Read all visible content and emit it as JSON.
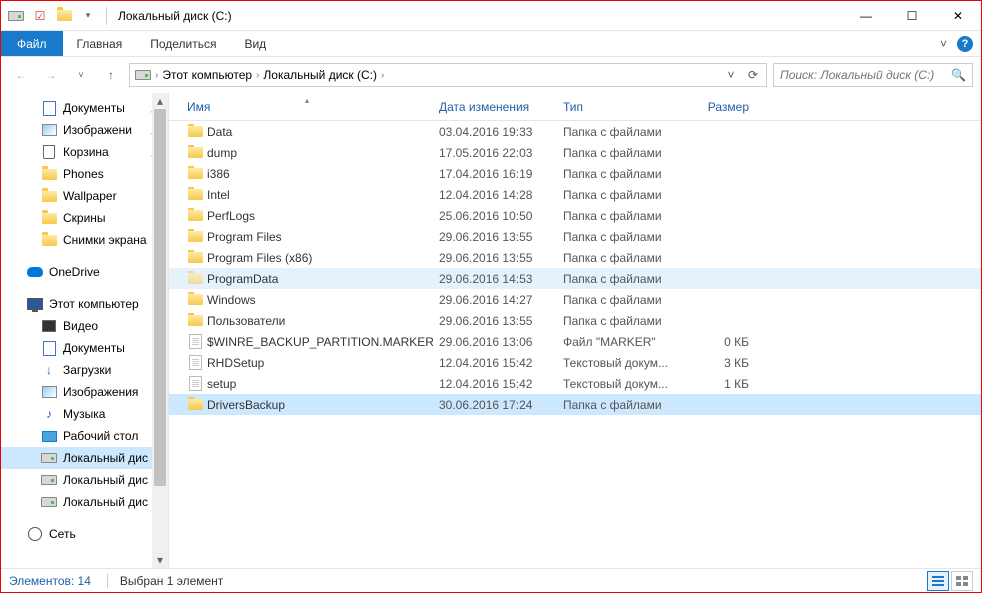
{
  "window": {
    "title": "Локальный диск (C:)",
    "minimize": "—",
    "maximize": "☐",
    "close": "✕"
  },
  "ribbon": {
    "file": "Файл",
    "tabs": [
      "Главная",
      "Поделиться",
      "Вид"
    ],
    "help": "?"
  },
  "nav": {
    "back": "←",
    "forward": "→",
    "up": "↑",
    "refresh": "⟳",
    "dropdown": "˅"
  },
  "address": {
    "crumbs": [
      "Этот компьютер",
      "Локальный диск (C:)"
    ],
    "sep": "›"
  },
  "search": {
    "placeholder": "Поиск: Локальный диск (C:)",
    "icon": "🔍"
  },
  "navpane": {
    "quickaccess": [
      {
        "label": "Документы",
        "icon": "doc",
        "pinned": true
      },
      {
        "label": "Изображени",
        "icon": "pic",
        "pinned": true
      },
      {
        "label": "Корзина",
        "icon": "trash",
        "pinned": true
      },
      {
        "label": "Phones",
        "icon": "folder"
      },
      {
        "label": "Wallpaper",
        "icon": "folder"
      },
      {
        "label": "Скрины",
        "icon": "folder"
      },
      {
        "label": "Снимки экрана",
        "icon": "folder"
      }
    ],
    "onedrive": "OneDrive",
    "thispc": "Этот компьютер",
    "thispc_items": [
      {
        "label": "Видео",
        "icon": "vid"
      },
      {
        "label": "Документы",
        "icon": "doc"
      },
      {
        "label": "Загрузки",
        "icon": "down"
      },
      {
        "label": "Изображения",
        "icon": "pic"
      },
      {
        "label": "Музыка",
        "icon": "music"
      },
      {
        "label": "Рабочий стол",
        "icon": "desk"
      },
      {
        "label": "Локальный дис",
        "icon": "drive",
        "selected": true
      },
      {
        "label": "Локальный дис",
        "icon": "drive"
      },
      {
        "label": "Локальный дис",
        "icon": "drive"
      }
    ],
    "network": "Сеть"
  },
  "columns": {
    "name": "Имя",
    "date": "Дата изменения",
    "type": "Тип",
    "size": "Размер"
  },
  "files": [
    {
      "name": "Data",
      "date": "03.04.2016 19:33",
      "type": "Папка с файлами",
      "size": "",
      "icon": "folder"
    },
    {
      "name": "dump",
      "date": "17.05.2016 22:03",
      "type": "Папка с файлами",
      "size": "",
      "icon": "folder"
    },
    {
      "name": "i386",
      "date": "17.04.2016 16:19",
      "type": "Папка с файлами",
      "size": "",
      "icon": "folder"
    },
    {
      "name": "Intel",
      "date": "12.04.2016 14:28",
      "type": "Папка с файлами",
      "size": "",
      "icon": "folder"
    },
    {
      "name": "PerfLogs",
      "date": "25.06.2016 10:50",
      "type": "Папка с файлами",
      "size": "",
      "icon": "folder"
    },
    {
      "name": "Program Files",
      "date": "29.06.2016 13:55",
      "type": "Папка с файлами",
      "size": "",
      "icon": "folder"
    },
    {
      "name": "Program Files (x86)",
      "date": "29.06.2016 13:55",
      "type": "Папка с файлами",
      "size": "",
      "icon": "folder"
    },
    {
      "name": "ProgramData",
      "date": "29.06.2016 14:53",
      "type": "Папка с файлами",
      "size": "",
      "icon": "folder-faded",
      "hover": true
    },
    {
      "name": "Windows",
      "date": "29.06.2016 14:27",
      "type": "Папка с файлами",
      "size": "",
      "icon": "folder"
    },
    {
      "name": "Пользователи",
      "date": "29.06.2016 13:55",
      "type": "Папка с файлами",
      "size": "",
      "icon": "folder"
    },
    {
      "name": "$WINRE_BACKUP_PARTITION.MARKER",
      "date": "29.06.2016 13:06",
      "type": "Файл \"MARKER\"",
      "size": "0 КБ",
      "icon": "file"
    },
    {
      "name": "RHDSetup",
      "date": "12.04.2016 15:42",
      "type": "Текстовый докум...",
      "size": "3 КБ",
      "icon": "file"
    },
    {
      "name": "setup",
      "date": "12.04.2016 15:42",
      "type": "Текстовый докум...",
      "size": "1 КБ",
      "icon": "file"
    },
    {
      "name": "DriversBackup",
      "date": "30.06.2016 17:24",
      "type": "Папка с файлами",
      "size": "",
      "icon": "folder",
      "selected": true
    }
  ],
  "status": {
    "count": "Элементов: 14",
    "selection": "Выбран 1 элемент"
  }
}
